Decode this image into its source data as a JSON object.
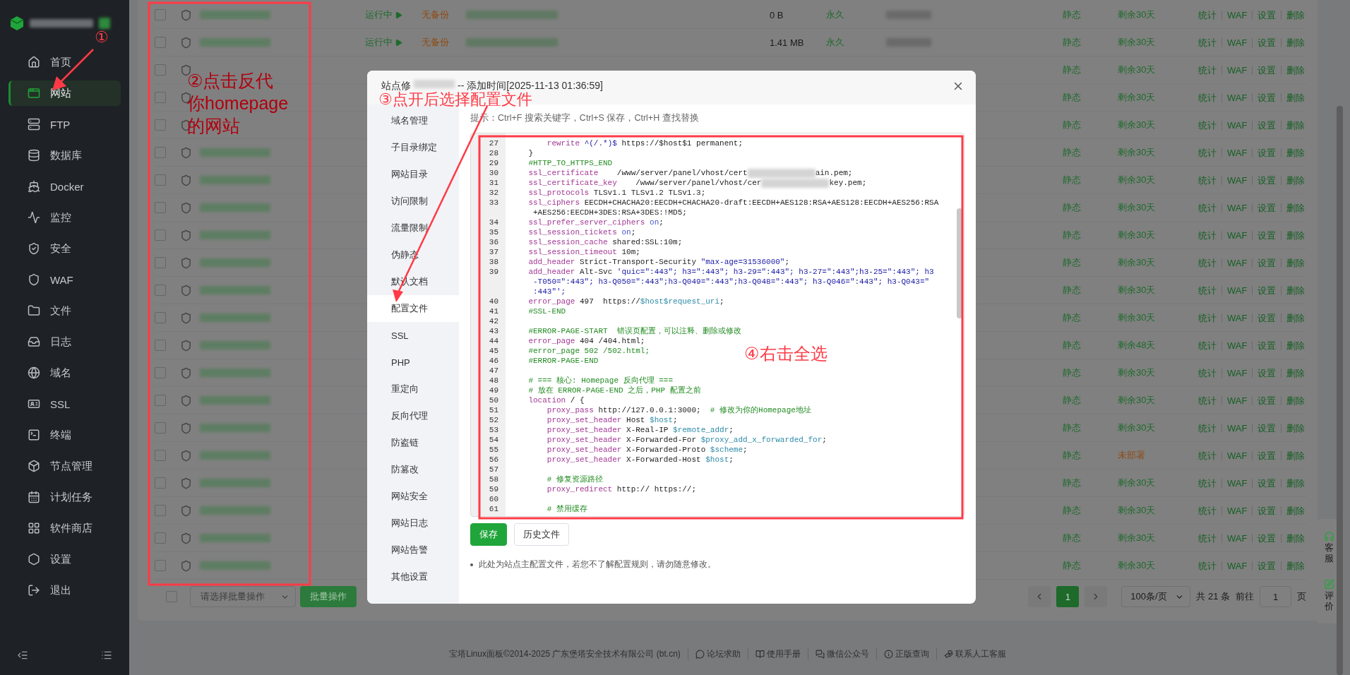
{
  "sidebar": {
    "items": [
      {
        "label": "首页",
        "selected": false
      },
      {
        "label": "网站",
        "selected": true
      },
      {
        "label": "FTP",
        "selected": false
      },
      {
        "label": "数据库",
        "selected": false
      },
      {
        "label": "Docker",
        "selected": false
      },
      {
        "label": "监控",
        "selected": false
      },
      {
        "label": "安全",
        "selected": false
      },
      {
        "label": "WAF",
        "selected": false
      },
      {
        "label": "文件",
        "selected": false
      },
      {
        "label": "日志",
        "selected": false
      },
      {
        "label": "域名",
        "selected": false
      },
      {
        "label": "SSL",
        "selected": false
      },
      {
        "label": "终端",
        "selected": false
      },
      {
        "label": "节点管理",
        "selected": false
      },
      {
        "label": "计划任务",
        "selected": false
      },
      {
        "label": "软件商店",
        "selected": false
      },
      {
        "label": "设置",
        "selected": false
      },
      {
        "label": "退出",
        "selected": false
      }
    ]
  },
  "table": {
    "rows": [
      {
        "checked": false,
        "status": "运行中",
        "backup": "无备份",
        "size": "0 B",
        "expiry": "永久",
        "type": "静态",
        "ssl": "剩余30天",
        "color": "#1d6a2b",
        "actions": [
          "统计",
          "WAF",
          "设置",
          "删除"
        ]
      },
      {
        "checked": false,
        "status": "运行中",
        "backup": "无备份",
        "size": "1.41 MB",
        "expiry": "永久",
        "type": "静态",
        "ssl": "剩余30天",
        "color": "#1d6a2b",
        "actions": [
          "统计",
          "WAF",
          "设置",
          "删除"
        ]
      },
      {
        "checked": false,
        "type": "静态",
        "ssl": "剩余30天",
        "color": "#1d6a2b",
        "actions": [
          "统计",
          "WAF",
          "设置",
          "删除"
        ]
      },
      {
        "checked": false,
        "type": "静态",
        "ssl": "剩余30天",
        "color": "#1d6a2b",
        "actions": [
          "统计",
          "WAF",
          "设置",
          "删除"
        ]
      },
      {
        "checked": false,
        "type": "静态",
        "ssl": "剩余30天",
        "color": "#1d6a2b",
        "actions": [
          "统计",
          "WAF",
          "设置",
          "删除"
        ]
      },
      {
        "checked": false,
        "type": "静态",
        "ssl": "剩余30天",
        "color": "#1d6a2b",
        "actions": [
          "统计",
          "WAF",
          "设置",
          "删除"
        ]
      },
      {
        "checked": false,
        "type": "静态",
        "ssl": "剩余30天",
        "color": "#1d6a2b",
        "actions": [
          "统计",
          "WAF",
          "设置",
          "删除"
        ]
      },
      {
        "checked": false,
        "type": "静态",
        "ssl": "剩余30天",
        "color": "#1d6a2b",
        "actions": [
          "统计",
          "WAF",
          "设置",
          "删除"
        ]
      },
      {
        "checked": false,
        "type": "静态",
        "ssl": "剩余30天",
        "color": "#1d6a2b",
        "actions": [
          "统计",
          "WAF",
          "设置",
          "删除"
        ]
      },
      {
        "checked": false,
        "type": "静态",
        "ssl": "剩余30天",
        "color": "#1d6a2b",
        "actions": [
          "统计",
          "WAF",
          "设置",
          "删除"
        ]
      },
      {
        "checked": false,
        "type": "静态",
        "ssl": "剩余30天",
        "color": "#1d6a2b",
        "actions": [
          "统计",
          "WAF",
          "设置",
          "删除"
        ]
      },
      {
        "checked": false,
        "type": "静态",
        "ssl": "剩余30天",
        "color": "#1d6a2b",
        "actions": [
          "统计",
          "WAF",
          "设置",
          "删除"
        ]
      },
      {
        "checked": false,
        "type": "静态",
        "ssl": "剩余48天",
        "color": "#1d6a2b",
        "actions": [
          "统计",
          "WAF",
          "设置",
          "删除"
        ]
      },
      {
        "checked": false,
        "type": "静态",
        "ssl": "剩余30天",
        "color": "#1d6a2b",
        "actions": [
          "统计",
          "WAF",
          "设置",
          "删除"
        ]
      },
      {
        "checked": false,
        "type": "静态",
        "ssl": "剩余30天",
        "color": "#1d6a2b",
        "actions": [
          "统计",
          "WAF",
          "设置",
          "删除"
        ]
      },
      {
        "checked": false,
        "type": "静态",
        "ssl": "剩余30天",
        "color": "#1d6a2b",
        "actions": [
          "统计",
          "WAF",
          "设置",
          "删除"
        ]
      },
      {
        "checked": false,
        "type": "静态",
        "ssl": "未部署",
        "color": "#8f4a12",
        "actions": [
          "统计",
          "WAF",
          "设置",
          "删除"
        ]
      },
      {
        "checked": false,
        "type": "静态",
        "ssl": "剩余30天",
        "color": "#1d6a2b",
        "actions": [
          "统计",
          "WAF",
          "设置",
          "删除"
        ]
      },
      {
        "checked": false,
        "type": "静态",
        "ssl": "剩余30天",
        "color": "#1d6a2b",
        "actions": [
          "统计",
          "WAF",
          "设置",
          "删除"
        ]
      },
      {
        "checked": false,
        "type": "静态",
        "ssl": "剩余30天",
        "color": "#1d6a2b",
        "actions": [
          "统计",
          "WAF",
          "设置",
          "删除"
        ]
      },
      {
        "checked": false,
        "type": "静态",
        "ssl": "剩余30天",
        "color": "#1d6a2b",
        "actions": [
          "统计",
          "WAF",
          "设置",
          "删除"
        ]
      }
    ]
  },
  "bulk": {
    "checked": false,
    "placeholder": "请选择批量操作",
    "button": "批量操作"
  },
  "pagination": {
    "pages": [
      {
        "label": "1",
        "selected": true
      }
    ],
    "page_size": "100条/页",
    "total": "共 21 条",
    "goto": "前往",
    "goto_value": "1",
    "unit": "页"
  },
  "footer": {
    "copyright": "宝塔Linux面板©2014-2025 广东堡塔安全技术有限公司 (bt.cn)",
    "links": [
      "论坛求助",
      "使用手册",
      "微信公众号",
      "正版查询",
      "联系人工客服"
    ]
  },
  "float_panel": [
    "客服",
    "评价"
  ],
  "dialog": {
    "title_prefix": "站点修",
    "title_suffix": "-- 添加时间[2025-11-13 01:36:59]",
    "menu": [
      {
        "label": "域名管理",
        "selected": false
      },
      {
        "label": "子目录绑定",
        "selected": false
      },
      {
        "label": "网站目录",
        "selected": false
      },
      {
        "label": "访问限制",
        "selected": false
      },
      {
        "label": "流量限制",
        "selected": false
      },
      {
        "label": "伪静态",
        "selected": false
      },
      {
        "label": "默认文档",
        "selected": false
      },
      {
        "label": "配置文件",
        "selected": true
      },
      {
        "label": "SSL",
        "selected": false
      },
      {
        "label": "PHP",
        "selected": false
      },
      {
        "label": "重定向",
        "selected": false
      },
      {
        "label": "反向代理",
        "selected": false
      },
      {
        "label": "防盗链",
        "selected": false
      },
      {
        "label": "防篡改",
        "selected": false
      },
      {
        "label": "网站安全",
        "selected": false
      },
      {
        "label": "网站日志",
        "selected": false
      },
      {
        "label": "网站告警",
        "selected": false
      },
      {
        "label": "其他设置",
        "selected": false
      }
    ],
    "hint": "提示：Ctrl+F 搜索关键字，Ctrl+S 保存，Ctrl+H 查找替换",
    "lines": [
      {
        "n": "27",
        "rows": [
          [
            {
              "kind": "kw",
              "text": "        rewrite "
            },
            {
              "kind": "str",
              "text": "^(/.*)$"
            },
            {
              "kind": "plain",
              "text": " https://$host$1 permanent;"
            }
          ]
        ]
      },
      {
        "n": "28",
        "rows": [
          [
            {
              "kind": "plain",
              "text": "    }"
            }
          ]
        ]
      },
      {
        "n": "29",
        "rows": [
          [
            {
              "kind": "com",
              "text": "    #HTTP_TO_HTTPS_END"
            }
          ]
        ]
      },
      {
        "n": "30",
        "rows": [
          [
            {
              "kind": "kw",
              "text": "    ssl_certificate"
            },
            {
              "kind": "plain",
              "text": "    /www/server/panel/vhost/cert"
            },
            {
              "kind": "blur"
            },
            {
              "kind": "plain",
              "text": "ain.pem;"
            }
          ]
        ]
      },
      {
        "n": "31",
        "rows": [
          [
            {
              "kind": "kw",
              "text": "    ssl_certificate_key"
            },
            {
              "kind": "plain",
              "text": "    /www/server/panel/vhost/cer"
            },
            {
              "kind": "blur"
            },
            {
              "kind": "plain",
              "text": "key.pem;"
            }
          ]
        ]
      },
      {
        "n": "32",
        "rows": [
          [
            {
              "kind": "kw",
              "text": "    ssl_protocols"
            },
            {
              "kind": "plain",
              "text": " TLSv1.1 TLSv1.2 TLSv1.3;"
            }
          ]
        ]
      },
      {
        "n": "33",
        "rows": [
          [
            {
              "kind": "kw",
              "text": "    ssl_ciphers"
            },
            {
              "kind": "plain",
              "text": " EECDH+CHACHA20:EECDH+CHACHA20-draft:EECDH+AES128:RSA+AES128:EECDH+AES256:RSA"
            }
          ],
          [
            {
              "kind": "plain",
              "text": "     +AES256:EECDH+3DES:RSA+3DES:!MD5;"
            }
          ]
        ]
      },
      {
        "n": "34",
        "rows": [
          [
            {
              "kind": "kw",
              "text": "    ssl_prefer_server_ciphers"
            },
            {
              "kind": "plain",
              "text": " "
            },
            {
              "kind": "atom",
              "text": "on"
            },
            {
              "kind": "plain",
              "text": ";"
            }
          ]
        ]
      },
      {
        "n": "35",
        "rows": [
          [
            {
              "kind": "kw",
              "text": "    ssl_session_tickets"
            },
            {
              "kind": "plain",
              "text": " "
            },
            {
              "kind": "atom",
              "text": "on"
            },
            {
              "kind": "plain",
              "text": ";"
            }
          ]
        ]
      },
      {
        "n": "36",
        "rows": [
          [
            {
              "kind": "kw",
              "text": "    ssl_session_cache"
            },
            {
              "kind": "plain",
              "text": " shared:SSL:10m;"
            }
          ]
        ]
      },
      {
        "n": "37",
        "rows": [
          [
            {
              "kind": "kw",
              "text": "    ssl_session_timeout"
            },
            {
              "kind": "plain",
              "text": " 10m;"
            }
          ]
        ]
      },
      {
        "n": "38",
        "rows": [
          [
            {
              "kind": "kw",
              "text": "    add_header"
            },
            {
              "kind": "plain",
              "text": " Strict-Transport-Security "
            },
            {
              "kind": "str",
              "text": "\"max-age=31536000\""
            },
            {
              "kind": "plain",
              "text": ";"
            }
          ]
        ]
      },
      {
        "n": "39",
        "rows": [
          [
            {
              "kind": "kw",
              "text": "    add_header"
            },
            {
              "kind": "plain",
              "text": " Alt-Svc "
            },
            {
              "kind": "str",
              "text": "'quic=\":443\"; h3=\":443\"; h3-29=\":443\"; h3-27=\":443\";h3-25=\":443\"; h3"
            }
          ],
          [
            {
              "kind": "str",
              "text": "     -T050=\":443\"; h3-Q050=\":443\";h3-Q049=\":443\";h3-Q048=\":443\"; h3-Q046=\":443\"; h3-Q043=\""
            }
          ],
          [
            {
              "kind": "str",
              "text": "     :443\"';"
            }
          ]
        ]
      },
      {
        "n": "40",
        "rows": [
          [
            {
              "kind": "kw",
              "text": "    error_page"
            },
            {
              "kind": "plain",
              "text": " 497  https://"
            },
            {
              "kind": "var",
              "text": "$host$request_uri"
            },
            {
              "kind": "plain",
              "text": ";"
            }
          ]
        ]
      },
      {
        "n": "41",
        "rows": [
          [
            {
              "kind": "com",
              "text": "    #SSL-END"
            }
          ]
        ]
      },
      {
        "n": "42"
      },
      {
        "n": "43",
        "rows": [
          [
            {
              "kind": "com",
              "text": "    #ERROR-PAGE-START  错误页配置，可以注释、删除或修改"
            }
          ]
        ]
      },
      {
        "n": "44",
        "rows": [
          [
            {
              "kind": "kw",
              "text": "    error_page"
            },
            {
              "kind": "plain",
              "text": " 404 /404.html;"
            }
          ]
        ]
      },
      {
        "n": "45",
        "rows": [
          [
            {
              "kind": "com",
              "text": "    #error_page 502 /502.html;"
            }
          ]
        ]
      },
      {
        "n": "46",
        "rows": [
          [
            {
              "kind": "com",
              "text": "    #ERROR-PAGE-END"
            }
          ]
        ]
      },
      {
        "n": "47"
      },
      {
        "n": "48",
        "rows": [
          [
            {
              "kind": "com",
              "text": "    # === 核心: Homepage 反向代理 ==="
            }
          ]
        ]
      },
      {
        "n": "49",
        "rows": [
          [
            {
              "kind": "com",
              "text": "    # 放在 ERROR-PAGE-END 之后，PHP 配置之前"
            }
          ]
        ]
      },
      {
        "n": "50",
        "rows": [
          [
            {
              "kind": "kw",
              "text": "    location"
            },
            {
              "kind": "plain",
              "text": " / {"
            }
          ]
        ]
      },
      {
        "n": "51",
        "rows": [
          [
            {
              "kind": "kw",
              "text": "        proxy_pass"
            },
            {
              "kind": "plain",
              "text": " http://127.0.0.1:3000;  "
            },
            {
              "kind": "com",
              "text": "# 修改为你的Homepage地址"
            }
          ]
        ]
      },
      {
        "n": "52",
        "rows": [
          [
            {
              "kind": "kw",
              "text": "        proxy_set_header"
            },
            {
              "kind": "plain",
              "text": " Host "
            },
            {
              "kind": "var",
              "text": "$host"
            },
            {
              "kind": "plain",
              "text": ";"
            }
          ]
        ]
      },
      {
        "n": "53",
        "rows": [
          [
            {
              "kind": "kw",
              "text": "        proxy_set_header"
            },
            {
              "kind": "plain",
              "text": " X-Real-IP "
            },
            {
              "kind": "var",
              "text": "$remote_addr"
            },
            {
              "kind": "plain",
              "text": ";"
            }
          ]
        ]
      },
      {
        "n": "54",
        "rows": [
          [
            {
              "kind": "kw",
              "text": "        proxy_set_header"
            },
            {
              "kind": "plain",
              "text": " X-Forwarded-For "
            },
            {
              "kind": "var",
              "text": "$proxy_add_x_forwarded_for"
            },
            {
              "kind": "plain",
              "text": ";"
            }
          ]
        ]
      },
      {
        "n": "55",
        "rows": [
          [
            {
              "kind": "kw",
              "text": "        proxy_set_header"
            },
            {
              "kind": "plain",
              "text": " X-Forwarded-Proto "
            },
            {
              "kind": "var",
              "text": "$scheme"
            },
            {
              "kind": "plain",
              "text": ";"
            }
          ]
        ]
      },
      {
        "n": "56",
        "rows": [
          [
            {
              "kind": "kw",
              "text": "        proxy_set_header"
            },
            {
              "kind": "plain",
              "text": " X-Forwarded-Host "
            },
            {
              "kind": "var",
              "text": "$host"
            },
            {
              "kind": "plain",
              "text": ";"
            }
          ]
        ]
      },
      {
        "n": "57"
      },
      {
        "n": "58",
        "rows": [
          [
            {
              "kind": "com",
              "text": "        # 修复资源路径"
            }
          ]
        ]
      },
      {
        "n": "59",
        "rows": [
          [
            {
              "kind": "kw",
              "text": "        proxy_redirect"
            },
            {
              "kind": "plain",
              "text": " http:// https://;"
            }
          ]
        ]
      },
      {
        "n": "60"
      },
      {
        "n": "61",
        "rows": [
          [
            {
              "kind": "com",
              "text": "        # 禁用缓存"
            }
          ]
        ]
      }
    ],
    "buttons": [
      {
        "label": "保存",
        "kind": "primary"
      },
      {
        "label": "历史文件",
        "kind": "plain"
      }
    ],
    "note": "此处为站点主配置文件，若您不了解配置规则，请勿随意修改。"
  },
  "annotations": [
    {
      "lines": [
        "①"
      ]
    },
    {
      "lines": [
        "②点击反代",
        "你homepage",
        "的网站"
      ]
    },
    {
      "lines": [
        "③点开后选择配置文件"
      ]
    },
    {
      "lines": [
        "④右击全选"
      ]
    }
  ]
}
